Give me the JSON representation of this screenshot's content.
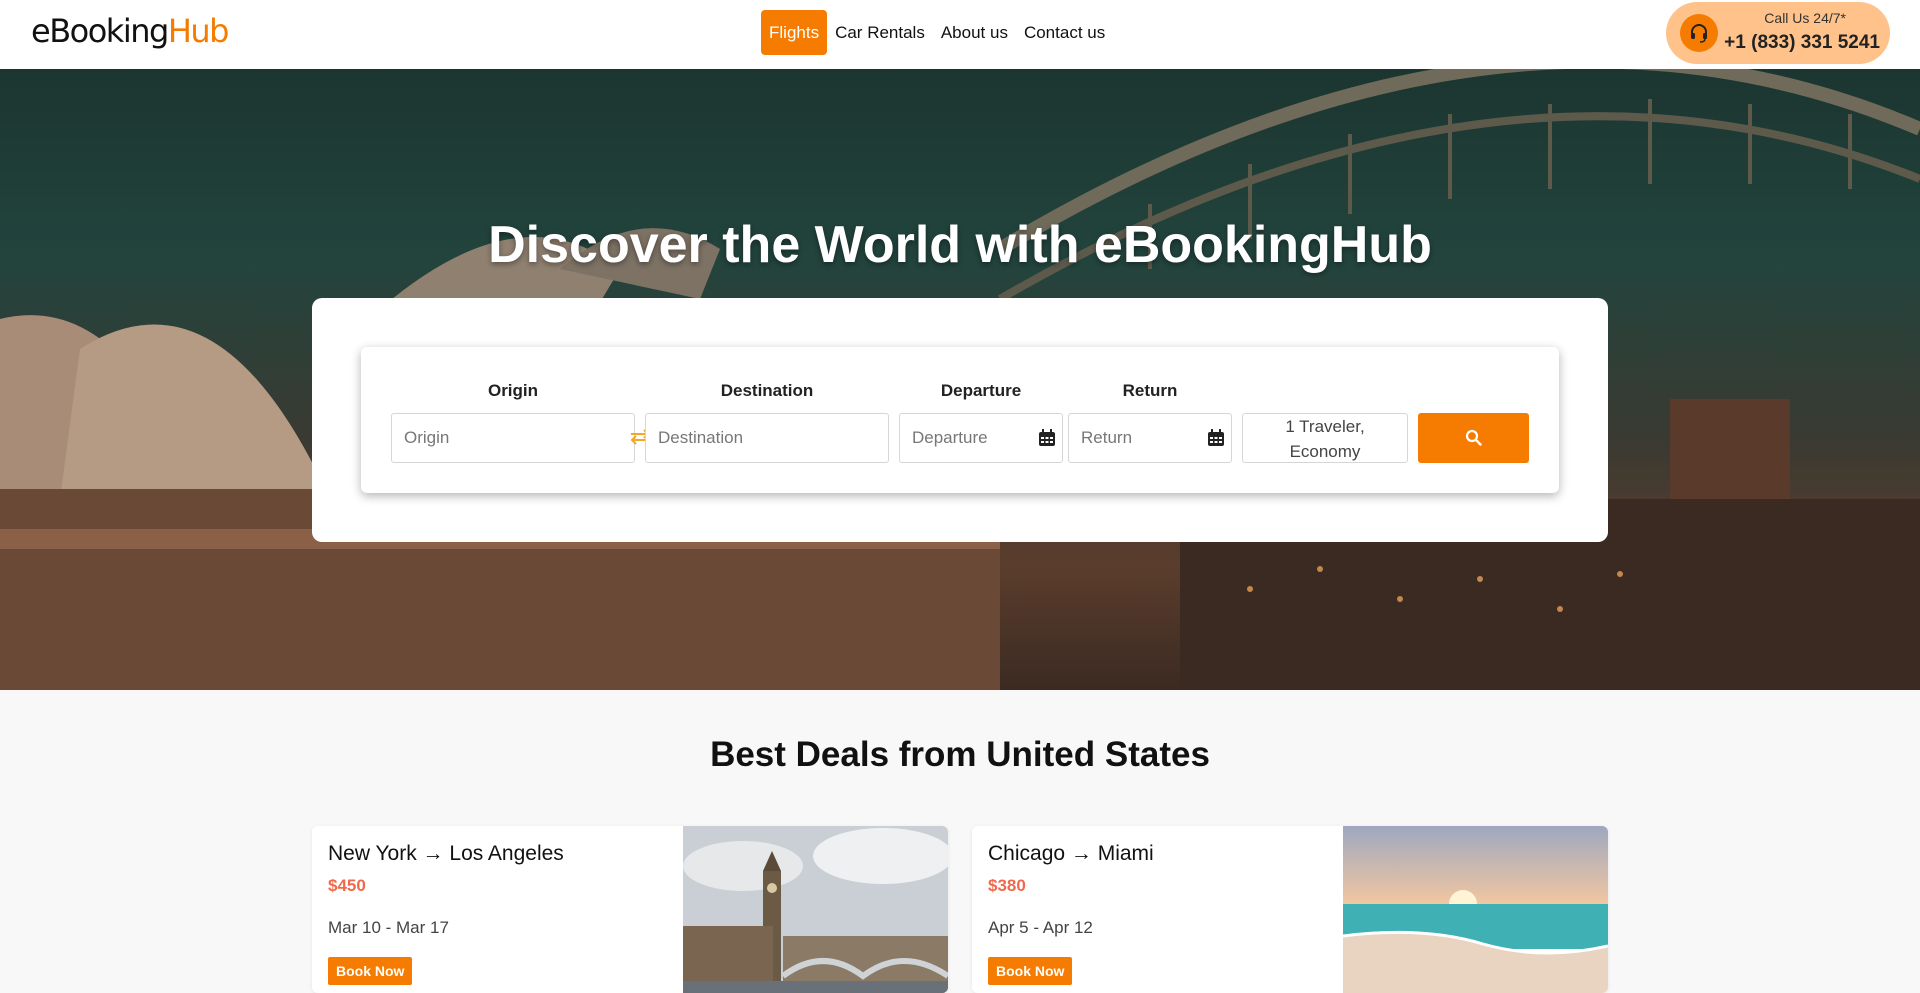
{
  "header": {
    "logo_part1": "eBooking",
    "logo_part2": "Hub",
    "nav": [
      "Flights",
      "Car Rentals",
      "About us",
      "Contact us"
    ],
    "active_nav": "Flights",
    "call_label": "Call Us 24/7*",
    "call_number": "+1 (833) 331 5241"
  },
  "hero": {
    "title": "Discover the World with eBookingHub"
  },
  "search": {
    "origin_label": "Origin",
    "origin_placeholder": "Origin",
    "destination_label": "Destination",
    "destination_placeholder": "Destination",
    "departure_label": "Departure",
    "departure_placeholder": "Departure",
    "return_label": "Return",
    "return_placeholder": "Return",
    "traveler_line1": "1 Traveler,",
    "traveler_line2": "Economy",
    "search_icon": "search-icon"
  },
  "deals": {
    "title": "Best Deals from United States",
    "items": [
      {
        "route": "New York → Los Angeles",
        "price": "$450",
        "dates": "Mar 10 - Mar 17",
        "button": "Book Now",
        "image": "london-big-ben-thames"
      },
      {
        "route": "Chicago → Miami",
        "price": "$380",
        "dates": "Apr 5 - Apr 12",
        "button": "Book Now",
        "image": "beach-sunset"
      }
    ]
  },
  "colors": {
    "accent": "#f57c00",
    "price": "#ef6a4c",
    "call_bg": "#ffc28a"
  }
}
